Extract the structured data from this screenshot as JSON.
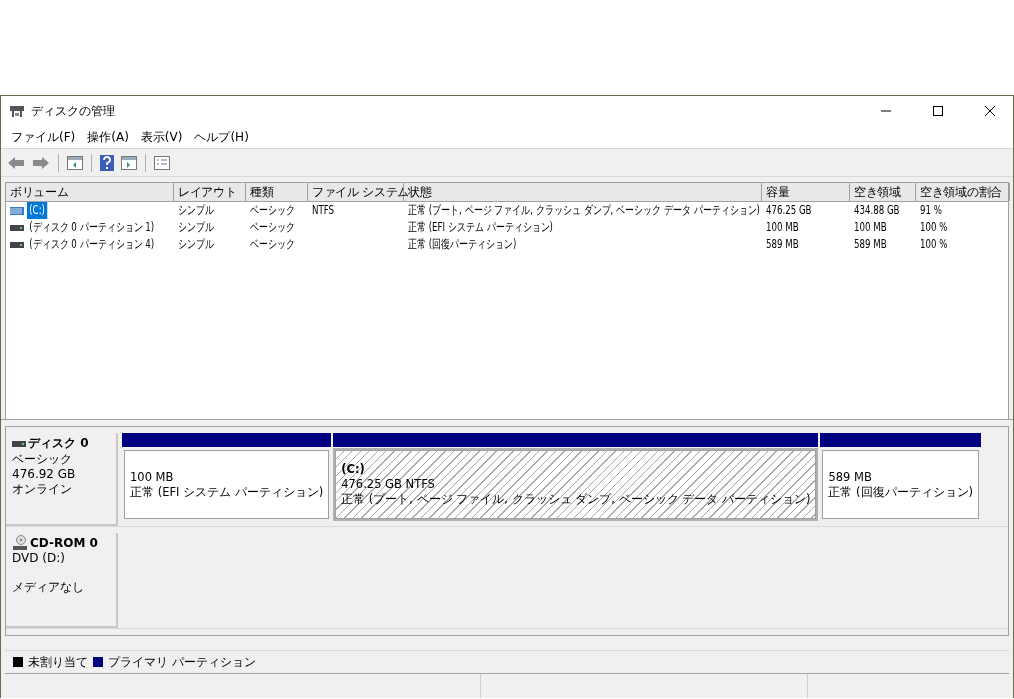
{
  "window": {
    "title": "ディスクの管理"
  },
  "menu": [
    "ファイル(F)",
    "操作(A)",
    "表示(V)",
    "ヘルプ(H)"
  ],
  "table": {
    "columns": [
      "ボリューム",
      "レイアウト",
      "種類",
      "ファイル システム",
      "状態",
      "容量",
      "空き領域",
      "空き領域の割合"
    ],
    "rows": [
      {
        "selected": true,
        "kind": "striped",
        "cells": [
          "(C:)",
          "シンプル",
          "ベーシック",
          "NTFS",
          "正常 (ブート, ページ ファイル, クラッシュ ダンプ, ベーシック データ パーティション)",
          "476.25 GB",
          "434.88 GB",
          "91 %"
        ]
      },
      {
        "selected": false,
        "kind": "plain",
        "cells": [
          "(ディスク 0 パーティション 1)",
          "シンプル",
          "ベーシック",
          "",
          "正常 (EFI システム パーティション)",
          "100 MB",
          "100 MB",
          "100 %"
        ]
      },
      {
        "selected": false,
        "kind": "plain",
        "cells": [
          "(ディスク 0 パーティション 4)",
          "シンプル",
          "ベーシック",
          "",
          "正常 (回復パーティション)",
          "589 MB",
          "589 MB",
          "100 %"
        ]
      }
    ]
  },
  "disks": [
    {
      "kind": "disk",
      "name": "ディスク 0",
      "lines": [
        "ベーシック",
        "476.92 GB",
        "オンライン"
      ],
      "partitions": [
        {
          "selected": false,
          "color": "#000080",
          "lines": [
            "100 MB",
            "正常 (EFI システム パーティション)"
          ]
        },
        {
          "selected": true,
          "color": "#000080",
          "title": "(C:)",
          "lines": [
            "476.25 GB NTFS",
            "正常 (ブート, ページ ファイル, クラッシュ ダンプ, ベーシック データ パーティション)"
          ]
        },
        {
          "selected": false,
          "color": "#000080",
          "lines": [
            "589 MB",
            "正常 (回復パーティション)"
          ]
        }
      ]
    },
    {
      "kind": "cdrom",
      "name": "CD-ROM 0",
      "lines": [
        "DVD (D:)",
        "メディアなし"
      ]
    }
  ],
  "legend": [
    {
      "label": "未割り当て",
      "color": "#000000"
    },
    {
      "label": "プライマリ パーティション",
      "color": "#000080"
    }
  ]
}
